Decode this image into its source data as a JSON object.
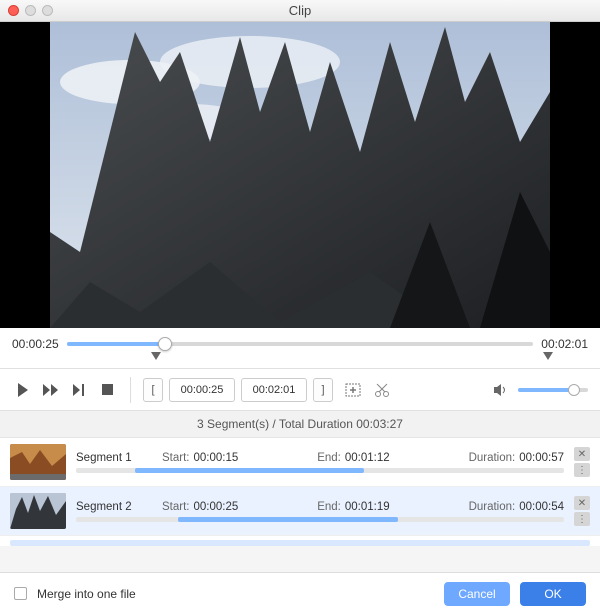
{
  "window": {
    "title": "Clip"
  },
  "playback": {
    "current_time": "00:00:25",
    "total_time": "00:02:01",
    "progress_pct": 21,
    "marker_in_pct": 21,
    "marker_out_pct": 100,
    "in_time": "00:00:25",
    "out_time": "00:02:01",
    "volume_pct": 80
  },
  "segments_header": {
    "count_label": "3 Segment(s)",
    "sep": " / ",
    "total_label": "Total Duration 00:03:27"
  },
  "labels": {
    "start": "Start:",
    "end": "End:",
    "duration": "Duration:",
    "merge": "Merge into one file",
    "cancel": "Cancel",
    "ok": "OK"
  },
  "segments": [
    {
      "name": "Segment 1",
      "start": "00:00:15",
      "end": "00:01:12",
      "duration": "00:00:57",
      "bar_left_pct": 12,
      "bar_width_pct": 47,
      "selected": false,
      "thumb": "canyon"
    },
    {
      "name": "Segment 2",
      "start": "00:00:25",
      "end": "00:01:19",
      "duration": "00:00:54",
      "bar_left_pct": 21,
      "bar_width_pct": 45,
      "selected": true,
      "thumb": "rocks"
    }
  ],
  "merge_checked": false
}
